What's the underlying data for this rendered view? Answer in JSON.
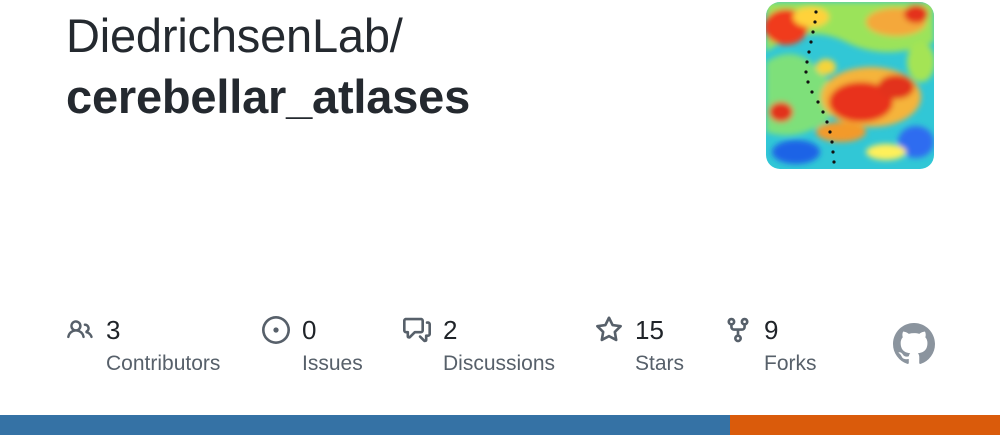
{
  "repo": {
    "owner": "DiedrichsenLab/",
    "name": "cerebellar_atlases"
  },
  "stats": [
    {
      "icon": "people-icon",
      "value": "3",
      "label": "Contributors"
    },
    {
      "icon": "issue-opened-icon",
      "value": "0",
      "label": "Issues"
    },
    {
      "icon": "discussions-icon",
      "value": "2",
      "label": "Discussions"
    },
    {
      "icon": "star-icon",
      "value": "15",
      "label": "Stars"
    },
    {
      "icon": "fork-icon",
      "value": "9",
      "label": "Forks"
    }
  ],
  "colors": {
    "text": "#24292f",
    "muted": "#57606a",
    "icon": "#57606a",
    "github_mark": "#8b949e"
  },
  "language_bar": [
    {
      "color": "#3572A5",
      "percent": 73
    },
    {
      "color": "#DA5B0B",
      "percent": 27
    }
  ]
}
